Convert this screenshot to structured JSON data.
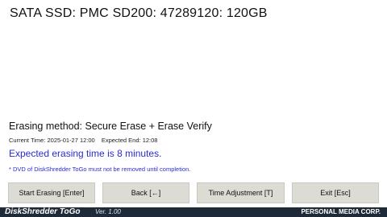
{
  "disk": {
    "title": "SATA SSD: PMC SD200: 47289120: 120GB"
  },
  "erase": {
    "method": "Erasing method: Secure Erase + Erase Verify",
    "current_time": "Current Time:  2025-01-27 12:00",
    "expected_end": "Expected End:  12:08",
    "estimate": "Expected erasing time is 8 minutes.",
    "notice": "* DVD of DiskShredder ToGo must not be removed until completion."
  },
  "buttons": {
    "start": "Start Erasing [Enter]",
    "back": "Back [←]",
    "time_adjust": "Time Adjustment [T]",
    "exit": "Exit [Esc]"
  },
  "footer": {
    "product": "DiskShredder ToGo",
    "version": "Ver. 1.00",
    "company": "PERSONAL MEDIA CORP."
  },
  "colors": {
    "accent_text": "#2a2ad8",
    "button_bg": "#dcdcd4",
    "footer_bg": "#1e2a38"
  }
}
